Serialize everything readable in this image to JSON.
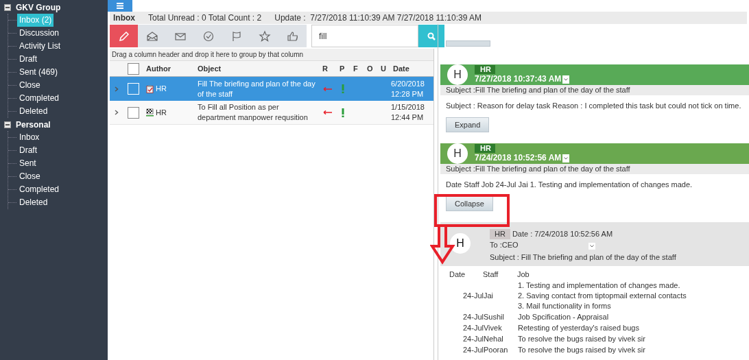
{
  "sidebar": {
    "groups": [
      {
        "label": "GKV Group",
        "expanded": true,
        "children": [
          {
            "label": "Inbox (2)",
            "selected": true
          },
          {
            "label": "Discussion",
            "selected": false
          },
          {
            "label": "Activity List",
            "selected": false
          },
          {
            "label": "Draft",
            "selected": false
          },
          {
            "label": "Sent (469)",
            "selected": false
          },
          {
            "label": "Close",
            "selected": false
          },
          {
            "label": "Completed",
            "selected": false
          },
          {
            "label": "Deleted",
            "selected": false
          }
        ]
      },
      {
        "label": "Personal",
        "expanded": true,
        "children": [
          {
            "label": "Inbox",
            "selected": false
          },
          {
            "label": "Draft",
            "selected": false
          },
          {
            "label": "Sent",
            "selected": false
          },
          {
            "label": "Close",
            "selected": false
          },
          {
            "label": "Completed",
            "selected": false
          },
          {
            "label": "Deleted",
            "selected": false
          }
        ]
      }
    ]
  },
  "header": {
    "title": "Inbox",
    "counts": "Total Unread : 0 Total Count : 2",
    "update": "Update :  7/27/2018 11:10:39 AM 7/27/2018 11:10:39 AM"
  },
  "toolbar": [
    {
      "kind": "pencil"
    },
    {
      "kind": "open-envelope"
    },
    {
      "kind": "envelope"
    },
    {
      "kind": "check"
    },
    {
      "kind": "flag"
    },
    {
      "kind": "star"
    },
    {
      "kind": "thumb"
    }
  ],
  "search": {
    "value": "fill"
  },
  "grid": {
    "select_all_checked": false,
    "group_hint": "Drag a column header and drop it here to group by that column",
    "columns": [
      "Author",
      "Object",
      "R",
      "P",
      "F",
      "O",
      "U",
      "Date"
    ],
    "rows": [
      {
        "kind": "clipboard",
        "author": "HR",
        "object": "Fill The briefing and plan of the day of the staff",
        "date": "6/20/2018",
        "time": "12:28 PM",
        "selected": true,
        "checked": false
      },
      {
        "kind": "checkered",
        "author": "HR",
        "object": "To Fill all Position as per department manpower requsition",
        "date": "1/15/2018",
        "time": "12:44 PM",
        "selected": false,
        "checked": false
      }
    ]
  },
  "thread": {
    "messages": [
      {
        "avatar": "H",
        "sender": "HR",
        "time": "7/27/2018 10:37:43 AM",
        "subject": "Subject :Fill The briefing and plan of the day of the staff",
        "body": "Subject : Reason for delay task Reason : I completed this task but could not tick on time.",
        "button": "Expand"
      },
      {
        "avatar": "H",
        "sender": "HR",
        "time": "7/24/2018 10:52:56 AM",
        "subject": "Subject :Fill The briefing and plan of the day of the staff",
        "body": "Date Staff Job 24-Jul Jai 1. Testing and implementation of changes made.",
        "button": "Collapse"
      }
    ],
    "detail": {
      "avatar": "H",
      "sender": "HR",
      "date": "Date : 7/24/2018 10:52:56 AM",
      "to": "To :CEO",
      "subject": "Subject : Fill The briefing and plan of the day of the staff",
      "columns": [
        "Date",
        "Staff",
        "Job"
      ],
      "rows": [
        {
          "staff": "24-JulJai",
          "job": [
            "1. Testing and implementation of changes made.",
            "2. Saving contact from tiptopmail external contacts",
            "3. Mail functionality in forms"
          ]
        },
        {
          "staff": "24-JulSushil",
          "job": [
            "Job Spcification - Appraisal"
          ]
        },
        {
          "staff": "24-JulVivek",
          "job": [
            "Retesting of yesterday's raised bugs"
          ]
        },
        {
          "staff": "24-JulNehal",
          "job": [
            "To resolve the bugs raised by vivek sir"
          ]
        },
        {
          "staff": "24-JulPooran",
          "job": [
            "To resolve the bugs raised by vivek sir"
          ]
        }
      ]
    }
  }
}
